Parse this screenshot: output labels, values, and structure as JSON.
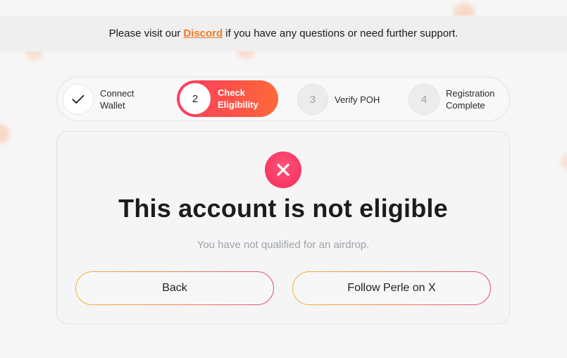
{
  "banner": {
    "text_before": "Please visit our",
    "link_text": "Discord",
    "text_after": "if you have any questions or need further support."
  },
  "stepper": {
    "steps": [
      {
        "number": "",
        "icon": "check-icon",
        "line1": "Connect",
        "line2": "Wallet",
        "state": "completed"
      },
      {
        "number": "2",
        "line1": "Check",
        "line2": "Eligibility",
        "state": "active"
      },
      {
        "number": "3",
        "line1": "Verify POH",
        "line2": "",
        "state": "pending"
      },
      {
        "number": "4",
        "line1": "Registration",
        "line2": "Complete",
        "state": "pending"
      }
    ]
  },
  "result": {
    "icon": "close-icon",
    "title": "This account is not eligible",
    "subtitle": "You have not qualified for an airdrop."
  },
  "actions": {
    "back_label": "Back",
    "follow_label": "Follow Perle on X"
  },
  "colors": {
    "accent_orange": "#f07a24",
    "active_step_gradient_start": "#fd3f63",
    "active_step_gradient_end": "#fd6a3a",
    "error_red": "#f93a66"
  }
}
